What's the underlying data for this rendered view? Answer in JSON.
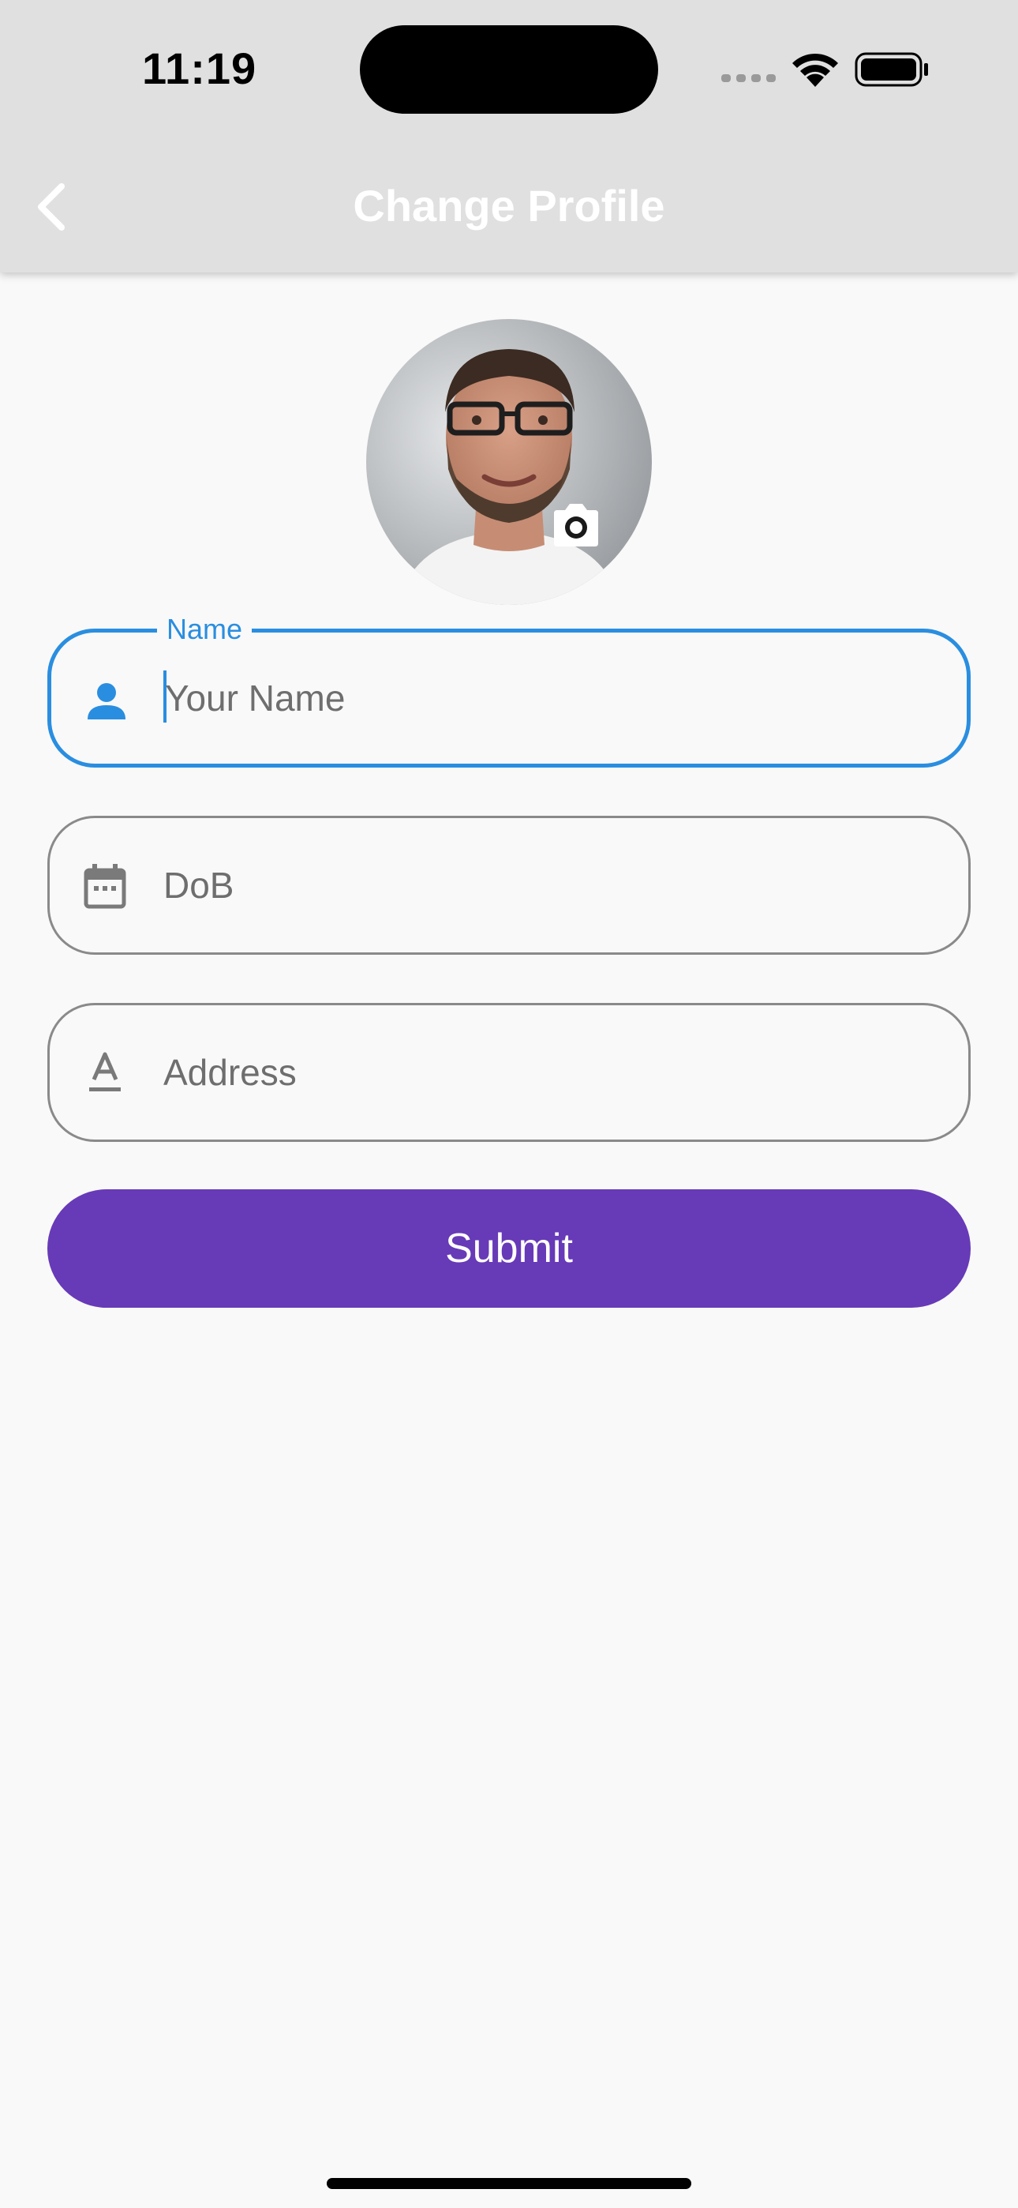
{
  "status_bar": {
    "time": "11:19"
  },
  "app_bar": {
    "title": "Change Profile"
  },
  "profile": {
    "avatar_icon": "person-photo-icon",
    "camera_icon": "camera-icon"
  },
  "form": {
    "name": {
      "label": "Name",
      "placeholder": "Your Name",
      "icon": "person-icon"
    },
    "dob": {
      "placeholder": "DoB",
      "icon": "calendar-icon"
    },
    "address": {
      "placeholder": "Address",
      "icon": "text-format-icon"
    },
    "submit_label": "Submit"
  },
  "colors": {
    "app_bar": "#e0e0e0",
    "focus": "#2a8ee0",
    "submit": "#673ab7",
    "background": "#f9f9f9"
  }
}
